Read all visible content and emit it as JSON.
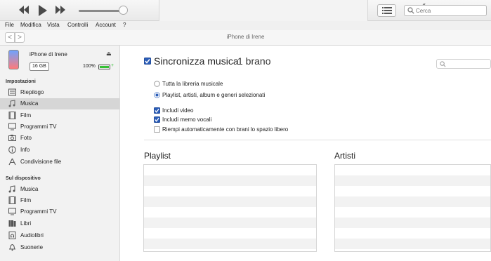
{
  "player": {
    "controls": [
      "rewind-icon",
      "play-icon",
      "fast-forward-icon"
    ],
    "volume_level": 0.9,
    "search_placeholder": "Cerca"
  },
  "menubar": {
    "items": [
      "File",
      "Modifica",
      "Vista",
      "Controlli",
      "Account",
      "?"
    ]
  },
  "nav": {
    "device_title": "iPhone di Irene",
    "back": "<",
    "forward": ">"
  },
  "device": {
    "name": "iPhone di Irene",
    "capacity": "16 GB",
    "battery": "100%",
    "battery_level": 1.0,
    "eject": "⏏",
    "charging": "+"
  },
  "sidebar": {
    "settings_label": "Impostazioni",
    "settings_items": [
      {
        "label": "Riepilogo",
        "icon": "summary-icon"
      },
      {
        "label": "Musica",
        "icon": "music-icon",
        "active": true
      },
      {
        "label": "Film",
        "icon": "film-icon"
      },
      {
        "label": "Programmi TV",
        "icon": "tv-icon"
      },
      {
        "label": "Foto",
        "icon": "camera-icon"
      },
      {
        "label": "Info",
        "icon": "info-icon"
      },
      {
        "label": "Condivisione file",
        "icon": "apps-icon"
      }
    ],
    "device_label": "Sul dispositivo",
    "device_items": [
      {
        "label": "Musica",
        "icon": "music-icon"
      },
      {
        "label": "Film",
        "icon": "film-icon"
      },
      {
        "label": "Programmi TV",
        "icon": "tv-icon"
      },
      {
        "label": "Libri",
        "icon": "books-icon"
      },
      {
        "label": "Audiolibri",
        "icon": "audiobook-icon"
      },
      {
        "label": "Suonerie",
        "icon": "bell-icon"
      }
    ]
  },
  "main": {
    "sync_title": "Sincronizza musica",
    "sync_count": "1 brano",
    "sync_checked": true,
    "radio_all": "Tutta la libreria musicale",
    "radio_selected": "Playlist, artisti, album e generi selezionati",
    "selected_radio": "radio_selected",
    "check_video": {
      "label": "Includi video",
      "checked": true
    },
    "check_memo": {
      "label": "Includi memo vocali",
      "checked": true
    },
    "check_fill": {
      "label": "Riempi automaticamente con brani lo spazio libero",
      "checked": false
    },
    "playlist_title": "Playlist",
    "artists_title": "Artisti"
  },
  "colors": {
    "accent": "#2b5db8",
    "battery": "#35c035",
    "active_item": "#d6d6d6"
  }
}
